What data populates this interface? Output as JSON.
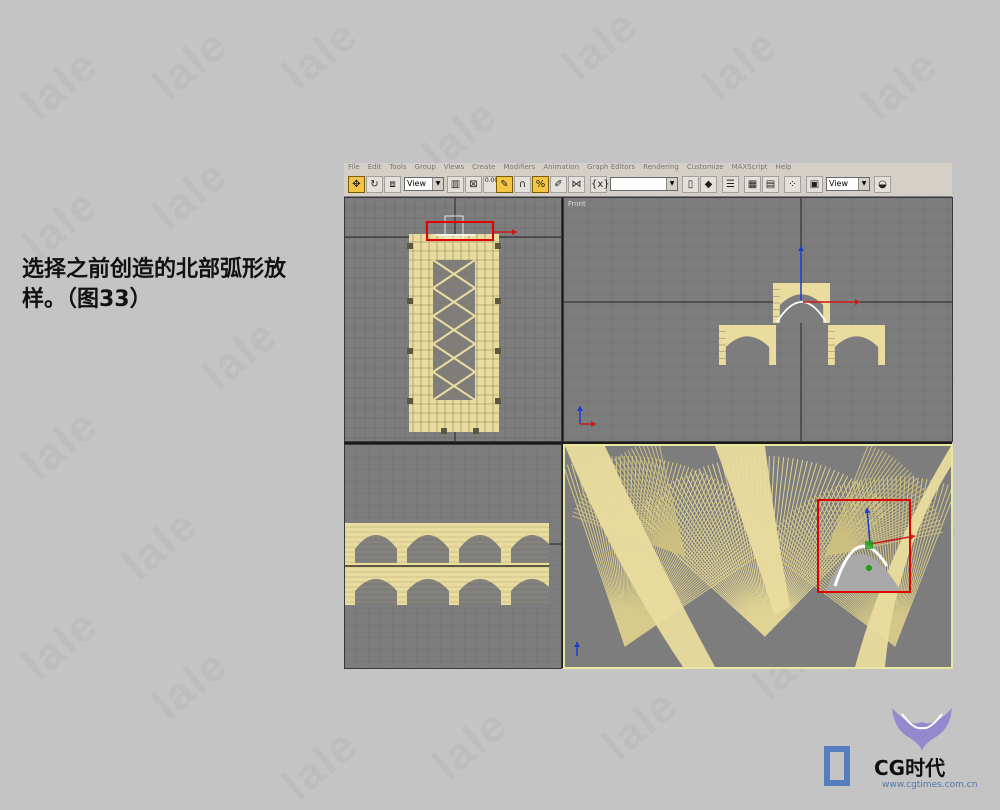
{
  "caption": "选择之前创造的北部弧形放样。（图33）",
  "watermark": "lale",
  "app": {
    "menu": [
      "File",
      "Edit",
      "Tools",
      "Group",
      "Views",
      "Create",
      "Modifiers",
      "Animation",
      "Graph Editors",
      "Rendering",
      "Customize",
      "MAXScript",
      "Help"
    ],
    "toolbar": {
      "coord_system_value": "View",
      "named_selection_value": "",
      "viewport_value": "View",
      "spinner_snap_value": "0.00"
    },
    "viewports": {
      "top_left": {
        "label": ""
      },
      "front": {
        "label": "Front"
      },
      "left": {
        "label": ""
      },
      "perspective": {
        "label": ""
      }
    },
    "colors": {
      "viewport_bg": "#7d7d7d",
      "geometry": "#e9dc9e",
      "selection_box": "#e00000",
      "gizmo_x": "#d01818",
      "gizmo_y": "#1a3ccc",
      "gizmo_z": "#18a018"
    }
  },
  "logo": {
    "text": "CG时代",
    "url": "www.cgtimes.com.cn"
  }
}
